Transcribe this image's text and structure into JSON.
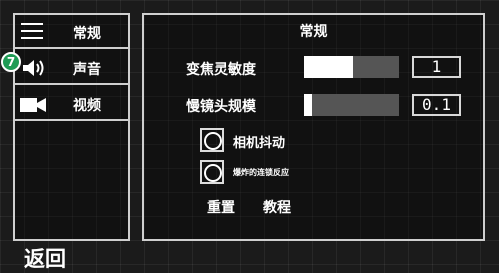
{
  "sidebar": {
    "items": [
      {
        "label": "常规",
        "icon": "menu-icon"
      },
      {
        "label": "声音",
        "icon": "speaker-icon"
      },
      {
        "label": "视频",
        "icon": "video-camera-icon"
      }
    ],
    "badge": "7"
  },
  "main": {
    "title": "常规",
    "sliders": [
      {
        "label": "变焦灵敏度",
        "value": "1",
        "fill_percent": 52
      },
      {
        "label": "慢镜头规模",
        "value": "0.1",
        "fill_percent": 8
      }
    ],
    "checkboxes": [
      {
        "label": "相机抖动"
      },
      {
        "label": "爆炸的连锁反应"
      }
    ],
    "actions": {
      "reset": "重置",
      "tutorial": "教程"
    }
  },
  "back_label": "返回"
}
